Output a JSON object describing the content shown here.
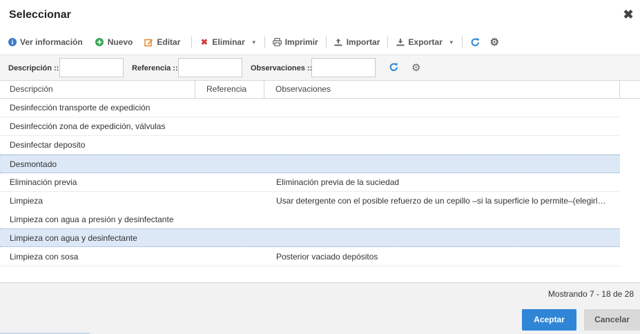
{
  "dialog": {
    "title": "Seleccionar",
    "close_icon": "close-icon"
  },
  "toolbar": {
    "ver_info": "Ver información",
    "nuevo": "Nuevo",
    "editar": "Editar",
    "eliminar": "Eliminar",
    "imprimir": "Imprimir",
    "importar": "Importar",
    "exportar": "Exportar"
  },
  "filters": {
    "descripcion_label": "Descripción ::",
    "referencia_label": "Referencia ::",
    "observaciones_label": "Observaciones ::",
    "descripcion_value": "",
    "referencia_value": "",
    "observaciones_value": ""
  },
  "grid": {
    "columns": [
      "Descripción",
      "Referencia",
      "Observaciones"
    ],
    "rows": [
      {
        "descripcion": "Desinfección transporte de expedición",
        "referencia": "",
        "observaciones": ""
      },
      {
        "descripcion": "Desinfección zona de expedición, válvulas",
        "referencia": "",
        "observaciones": ""
      },
      {
        "descripcion": "Desinfectar deposito",
        "referencia": "",
        "observaciones": ""
      },
      {
        "descripcion": "Desmontado",
        "referencia": "",
        "observaciones": ""
      },
      {
        "descripcion": "Eliminación previa",
        "referencia": "",
        "observaciones": "Eliminación previa de la suciedad"
      },
      {
        "descripcion": "Limpieza",
        "referencia": "",
        "observaciones": "Usar detergente con el posible refuerzo de un cepillo –si la superficie lo permite–(elegirl…"
      },
      {
        "descripcion": "Limpieza con agua a presión y desinfectante",
        "referencia": "",
        "observaciones": ""
      },
      {
        "descripcion": "Limpieza con agua y desinfectante",
        "referencia": "",
        "observaciones": ""
      },
      {
        "descripcion": "Limpieza con sosa",
        "referencia": "",
        "observaciones": "Posterior vaciado depósitos"
      }
    ]
  },
  "footer": {
    "paging": "Mostrando 7 - 18 de 28",
    "accept": "Aceptar",
    "cancel": "Cancelar"
  },
  "colors": {
    "accent": "#2f86d6",
    "selected_row": "#dde8f7",
    "info_icon": "#3a7cc8",
    "add_icon": "#3aa655",
    "edit_icon": "#e8862a",
    "delete_icon": "#d33c3c"
  }
}
